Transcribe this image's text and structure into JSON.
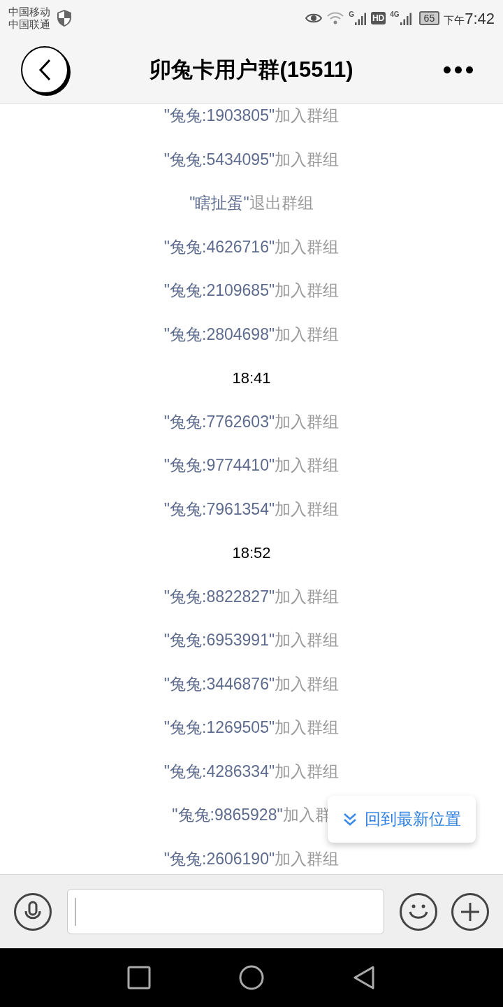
{
  "status_bar": {
    "carriers": [
      "中国移动",
      "中国联通"
    ],
    "sim1_label": "G",
    "hd_badge": "HD",
    "sim2_label": "4G",
    "battery": "65",
    "time_period": "下午",
    "time": "7:42"
  },
  "header": {
    "title": "卯兔卡用户群(15511)"
  },
  "messages": [
    {
      "kind": "notice",
      "name": "\"兔兔:1903805\"",
      "action": "加入群组"
    },
    {
      "kind": "notice",
      "name": "\"兔兔:5434095\"",
      "action": "加入群组"
    },
    {
      "kind": "notice",
      "name": "\"瞎扯蛋\"",
      "action": "退出群组"
    },
    {
      "kind": "notice",
      "name": "\"兔兔:4626716\"",
      "action": "加入群组"
    },
    {
      "kind": "notice",
      "name": "\"兔兔:2109685\"",
      "action": "加入群组"
    },
    {
      "kind": "notice",
      "name": "\"兔兔:2804698\"",
      "action": "加入群组"
    },
    {
      "kind": "time",
      "text": "18:41"
    },
    {
      "kind": "notice",
      "name": "\"兔兔:7762603\"",
      "action": "加入群组"
    },
    {
      "kind": "notice",
      "name": "\"兔兔:9774410\"",
      "action": "加入群组"
    },
    {
      "kind": "notice",
      "name": "\"兔兔:7961354\"",
      "action": "加入群组"
    },
    {
      "kind": "time",
      "text": "18:52"
    },
    {
      "kind": "notice",
      "name": "\"兔兔:8822827\"",
      "action": "加入群组"
    },
    {
      "kind": "notice",
      "name": "\"兔兔:6953991\"",
      "action": "加入群组"
    },
    {
      "kind": "notice",
      "name": "\"兔兔:3446876\"",
      "action": "加入群组"
    },
    {
      "kind": "notice",
      "name": "\"兔兔:1269505\"",
      "action": "加入群组"
    },
    {
      "kind": "notice",
      "name": "\"兔兔:4286334\"",
      "action": "加入群组"
    },
    {
      "kind": "notice",
      "name": "\"兔兔:9865928\"",
      "action": "加入群"
    },
    {
      "kind": "notice",
      "name": "\"兔兔:2606190\"",
      "action": "加入群组"
    }
  ],
  "jump_button": {
    "label": "回到最新位置"
  }
}
